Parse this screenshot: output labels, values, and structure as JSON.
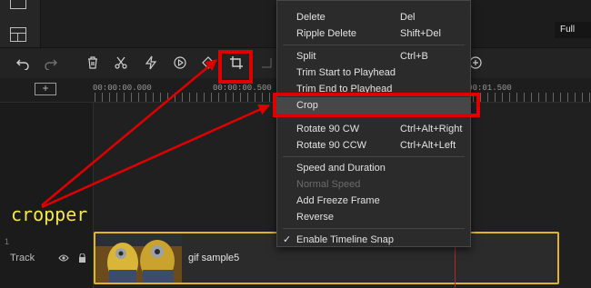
{
  "toolbar": {
    "icons": [
      "undo-icon",
      "redo-icon",
      "delete-icon",
      "scissors-icon",
      "lightning-icon",
      "speed-icon",
      "keyframe-icon",
      "crop-icon",
      "edit-icon",
      "add-icon"
    ]
  },
  "preview": {
    "size_option": "Full"
  },
  "timeline": {
    "timecodes": [
      "00:00:00.000",
      "00:00:00.500",
      "00:00:01.500"
    ],
    "track_number": "1",
    "track_label": "Track",
    "clip_name": "gif sample5"
  },
  "context_menu": {
    "items": [
      {
        "label": "Delete",
        "shortcut": "Del",
        "state": "normal"
      },
      {
        "label": "Ripple Delete",
        "shortcut": "Shift+Del",
        "state": "normal"
      },
      {
        "label": "Split",
        "shortcut": "Ctrl+B",
        "state": "normal"
      },
      {
        "label": "Trim Start to Playhead",
        "shortcut": "",
        "state": "normal"
      },
      {
        "label": "Trim End to Playhead",
        "shortcut": "",
        "state": "normal"
      },
      {
        "label": "Crop",
        "shortcut": "",
        "state": "highlighted"
      },
      {
        "label": "Rotate 90 CW",
        "shortcut": "Ctrl+Alt+Right",
        "state": "normal"
      },
      {
        "label": "Rotate 90 CCW",
        "shortcut": "Ctrl+Alt+Left",
        "state": "normal"
      },
      {
        "label": "Speed and Duration",
        "shortcut": "",
        "state": "normal"
      },
      {
        "label": "Normal Speed",
        "shortcut": "",
        "state": "disabled"
      },
      {
        "label": "Add Freeze Frame",
        "shortcut": "",
        "state": "normal"
      },
      {
        "label": "Reverse",
        "shortcut": "",
        "state": "normal"
      },
      {
        "label": "Enable Timeline Snap",
        "shortcut": "",
        "state": "checked"
      }
    ]
  },
  "annotation": {
    "text": "cropper",
    "color": "#e00000",
    "text_color": "#f5e84a"
  },
  "colors": {
    "clip_border": "#e2b529",
    "playhead": "#b12a2a"
  }
}
